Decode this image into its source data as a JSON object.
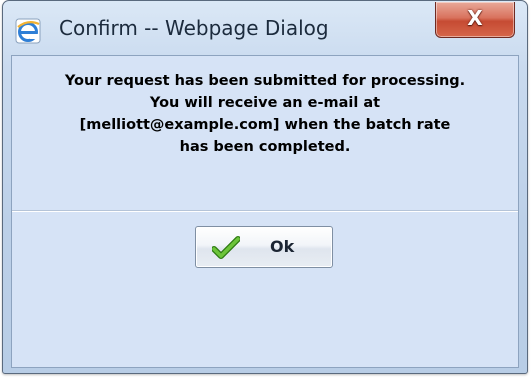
{
  "window": {
    "title": "Confirm -- Webpage Dialog",
    "title_icon": "internet-explorer-icon",
    "close_glyph": "X"
  },
  "message": {
    "lines": [
      "Your request has been submitted for processing.",
      "You will receive an e-mail at",
      "[melliott@example.com] when the batch rate",
      "has been completed."
    ]
  },
  "buttons": {
    "ok_label": "Ok",
    "ok_icon": "green-checkmark-icon"
  },
  "colors": {
    "client_background": "#d6e3f6",
    "close_button": "#c64b33",
    "check_green": "#3e9c1d"
  }
}
